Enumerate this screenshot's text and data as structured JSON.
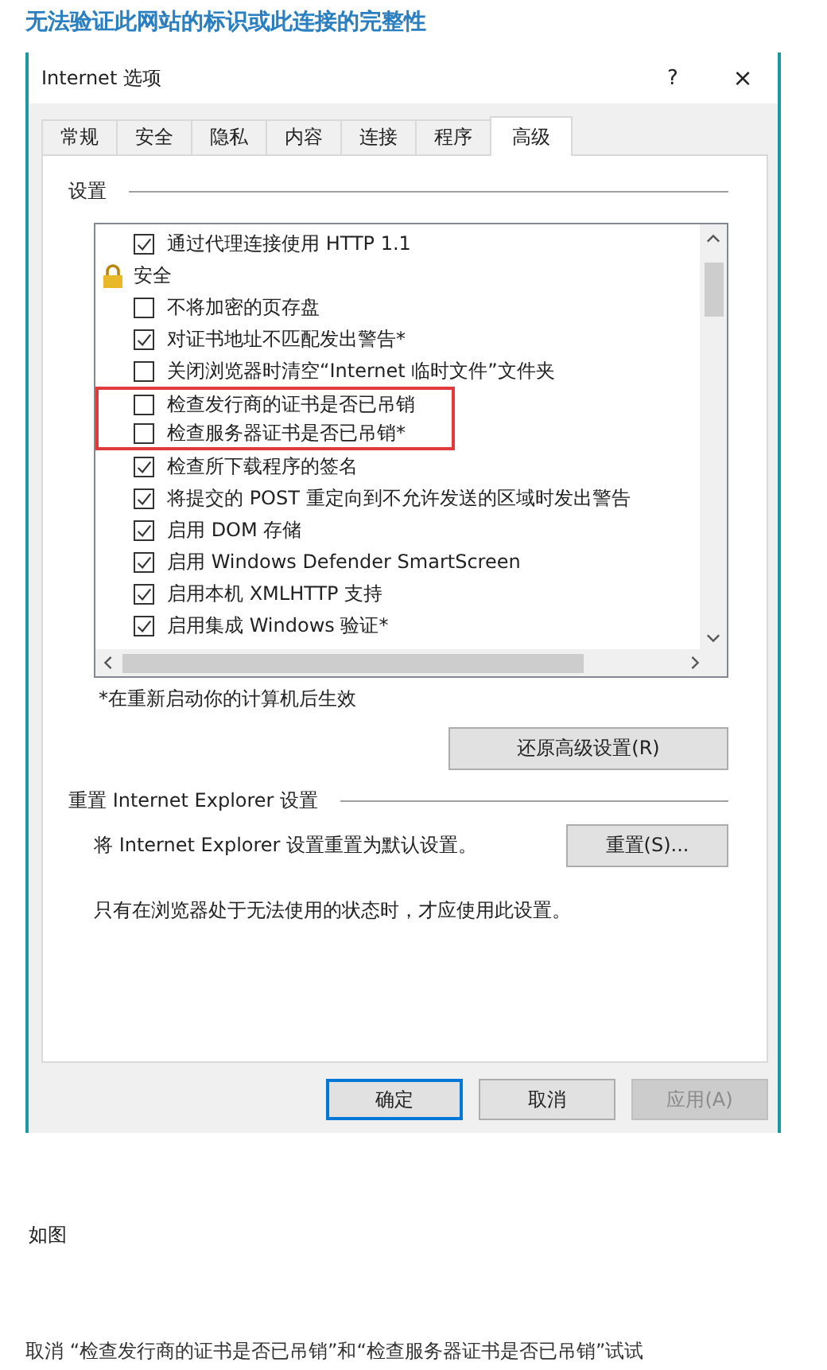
{
  "heading": "无法验证此网站的标识或此连接的完整性",
  "dialog": {
    "title": "Internet 选项",
    "help": "?",
    "close": "×",
    "tabs": [
      {
        "label": "常规",
        "selected": false
      },
      {
        "label": "安全",
        "selected": false
      },
      {
        "label": "隐私",
        "selected": false
      },
      {
        "label": "内容",
        "selected": false
      },
      {
        "label": "连接",
        "selected": false
      },
      {
        "label": "程序",
        "selected": false
      },
      {
        "label": "高级",
        "selected": true
      }
    ],
    "settings_label": "设置",
    "settings": [
      {
        "kind": "checkbox",
        "label": "通过代理连接使用 HTTP 1.1",
        "checked": true,
        "highlighted": false
      },
      {
        "kind": "category",
        "label": "安全",
        "highlighted": false
      },
      {
        "kind": "checkbox",
        "label": "不将加密的页存盘",
        "checked": false,
        "highlighted": false
      },
      {
        "kind": "checkbox",
        "label": "对证书地址不匹配发出警告*",
        "checked": true,
        "highlighted": false
      },
      {
        "kind": "checkbox",
        "label": "关闭浏览器时清空“Internet 临时文件”文件夹",
        "checked": false,
        "highlighted": false
      },
      {
        "kind": "checkbox",
        "label": "检查发行商的证书是否已吊销",
        "checked": false,
        "highlighted": true
      },
      {
        "kind": "checkbox",
        "label": "检查服务器证书是否已吊销*",
        "checked": false,
        "highlighted": true
      },
      {
        "kind": "checkbox",
        "label": "检查所下载程序的签名",
        "checked": true,
        "highlighted": false
      },
      {
        "kind": "checkbox",
        "label": "将提交的 POST 重定向到不允许发送的区域时发出警告",
        "checked": true,
        "highlighted": false
      },
      {
        "kind": "checkbox",
        "label": "启用 DOM 存储",
        "checked": true,
        "highlighted": false
      },
      {
        "kind": "checkbox",
        "label": "启用 Windows Defender SmartScreen",
        "checked": true,
        "highlighted": false
      },
      {
        "kind": "checkbox",
        "label": "启用本机 XMLHTTP 支持",
        "checked": true,
        "highlighted": false
      },
      {
        "kind": "checkbox",
        "label": "启用集成 Windows 验证*",
        "checked": true,
        "highlighted": false
      }
    ],
    "restart_note": "*在重新启动你的计算机后生效",
    "restore_button": "还原高级设置(R)",
    "reset_heading": "重置 Internet Explorer 设置",
    "reset_text": "将 Internet Explorer 设置重置为默认设置。",
    "reset_button": "重置(S)...",
    "reset_note": "只有在浏览器处于无法使用的状态时，才应使用此设置。",
    "buttons": [
      {
        "label": "确定",
        "kind": "default",
        "disabled": false
      },
      {
        "label": "取消",
        "kind": "normal",
        "disabled": false
      },
      {
        "label": "应用(A)",
        "kind": "normal",
        "disabled": true
      }
    ]
  },
  "caption": "如图",
  "instruction": "取消 “检查发行商的证书是否已吊销”和“检查服务器证书是否已吊销”试试"
}
